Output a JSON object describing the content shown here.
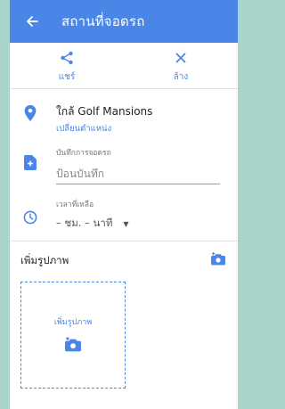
{
  "appbar": {
    "title": "สถานที่จอดรถ"
  },
  "actions": {
    "share_label": "แชร์",
    "clear_label": "ล้าง"
  },
  "location": {
    "name": "ใกล้ Golf Mansions",
    "change_label": "เปลี่ยนตำแหน่ง"
  },
  "note": {
    "label": "บันทึกการจอดรถ",
    "placeholder": "ป้อนบันทึก"
  },
  "time_left": {
    "label": "เวลาที่เหลือ",
    "value": "– ชม. – นาที"
  },
  "photos": {
    "title": "เพิ่มรูปภาพ",
    "dropzone_label": "เพิ่มรูปภาพ"
  },
  "colors": {
    "accent": "#4a86e8",
    "background": "#a9d4c9"
  }
}
